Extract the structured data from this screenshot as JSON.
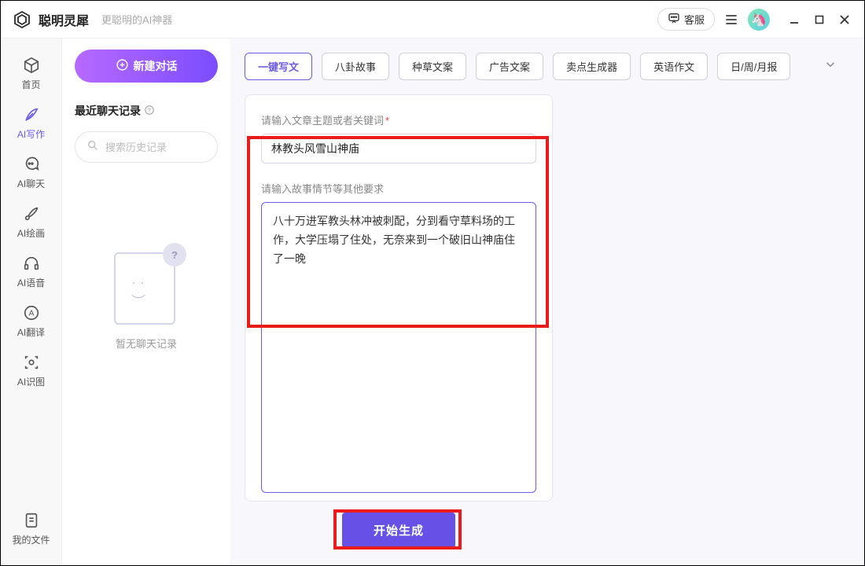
{
  "title": {
    "app_name": "聪明灵犀",
    "subtitle": "更聪明的AI神器",
    "cs_label": "客服"
  },
  "nav": {
    "items": [
      {
        "label": "首页"
      },
      {
        "label": "AI写作"
      },
      {
        "label": "AI聊天"
      },
      {
        "label": "AI绘画"
      },
      {
        "label": "AI语音"
      },
      {
        "label": "AI翻译"
      },
      {
        "label": "AI识图"
      }
    ],
    "footer": {
      "label": "我的文件"
    }
  },
  "sidebar": {
    "new_chat": "新建对话",
    "section_title": "最近聊天记录",
    "search_placeholder": "搜索历史记录",
    "empty_text": "暂无聊天记录"
  },
  "tabs": [
    "一键写文",
    "八卦故事",
    "种草文案",
    "广告文案",
    "卖点生成器",
    "英语作文",
    "日/周/月报"
  ],
  "form": {
    "topic_label": "请输入文章主题或者关键词",
    "topic_value": "林教头风雪山神庙",
    "detail_label": "请输入故事情节等其他要求",
    "detail_value": "八十万进军教头林冲被刺配，分到看守草料场的工作，大学压塌了住处，无奈来到一个破旧山神庙住了一晚"
  },
  "generate_label": "开始生成"
}
